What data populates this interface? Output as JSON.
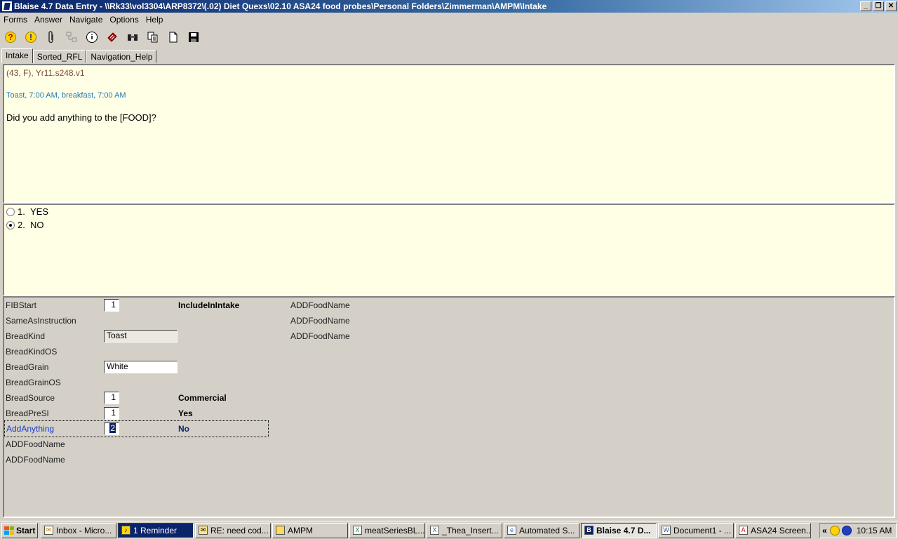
{
  "window": {
    "title": "Blaise 4.7 Data Entry - \\\\Rk33\\vol3304\\ARP8372\\(.02) Diet Quexs\\02.10 ASA24 food probes\\Personal Folders\\Zimmerman\\AMPM\\Intake",
    "minimize": "_",
    "restore": "❐",
    "close": "✕"
  },
  "menu": [
    "Forms",
    "Answer",
    "Navigate",
    "Options",
    "Help"
  ],
  "toolbar_icons": [
    "help-icon",
    "info-alert-icon",
    "paperclip-icon",
    "network-icon",
    "information-icon",
    "remark-icon",
    "binoculars-icon",
    "copy-icon",
    "new-form-icon",
    "save-icon"
  ],
  "tabs": [
    "Intake",
    "Sorted_RFL",
    "Navigation_Help"
  ],
  "question": {
    "meta": "(43, F),  Yr11.s248.v1",
    "context": "Toast, 7:00 AM, breakfast, 7:00 AM",
    "text": "Did you add anything to the [FOOD]?"
  },
  "answers": [
    {
      "code": "1.",
      "label": "YES",
      "selected": false
    },
    {
      "code": "2.",
      "label": "NO",
      "selected": true
    }
  ],
  "form": {
    "rows": [
      {
        "label": "FIBStart",
        "value": "1",
        "type": "num",
        "desc": "IncludeInIntake",
        "extra": "ADDFoodName"
      },
      {
        "label": "SameAsInstruction",
        "value": "",
        "type": "none",
        "desc": "",
        "extra": "ADDFoodName"
      },
      {
        "label": "BreadKind",
        "value": "Toast",
        "type": "txt-grey",
        "desc": "",
        "extra": "ADDFoodName"
      },
      {
        "label": "BreadKindOS",
        "value": "",
        "type": "none",
        "desc": "",
        "extra": ""
      },
      {
        "label": "BreadGrain",
        "value": "White",
        "type": "txt",
        "desc": "",
        "extra": ""
      },
      {
        "label": "BreadGrainOS",
        "value": "",
        "type": "none",
        "desc": "",
        "extra": ""
      },
      {
        "label": "BreadSource",
        "value": "1",
        "type": "num",
        "desc": "Commercial",
        "extra": ""
      },
      {
        "label": "BreadPreSl",
        "value": "1",
        "type": "num",
        "desc": "Yes",
        "extra": ""
      },
      {
        "label": "AddAnything",
        "value": "2",
        "type": "num-current",
        "desc": "No",
        "extra": ""
      },
      {
        "label": "ADDFoodName",
        "value": "",
        "type": "none",
        "desc": "",
        "extra": ""
      },
      {
        "label": "ADDFoodName",
        "value": "",
        "type": "none",
        "desc": "",
        "extra": ""
      }
    ]
  },
  "taskbar": {
    "start": "Start",
    "tasks": [
      {
        "label": "Inbox - Micro...",
        "icon": "outlook-icon"
      },
      {
        "label": "1 Reminder",
        "icon": "bell-icon"
      },
      {
        "label": "RE: need cod...",
        "icon": "envelope-icon"
      },
      {
        "label": "AMPM",
        "icon": "folder-icon"
      },
      {
        "label": "meatSeriesBL...",
        "icon": "excel-icon"
      },
      {
        "label": "_Thea_Insert...",
        "icon": "excel-icon"
      },
      {
        "label": "Automated S...",
        "icon": "ie-icon"
      },
      {
        "label": "Blaise 4.7 D...",
        "icon": "blaise-icon"
      },
      {
        "label": "Document1 - ...",
        "icon": "word-icon"
      },
      {
        "label": "ASA24 Screen...",
        "icon": "pdf-icon"
      }
    ],
    "clock": "10:15 AM",
    "tray_chevron": "«"
  }
}
